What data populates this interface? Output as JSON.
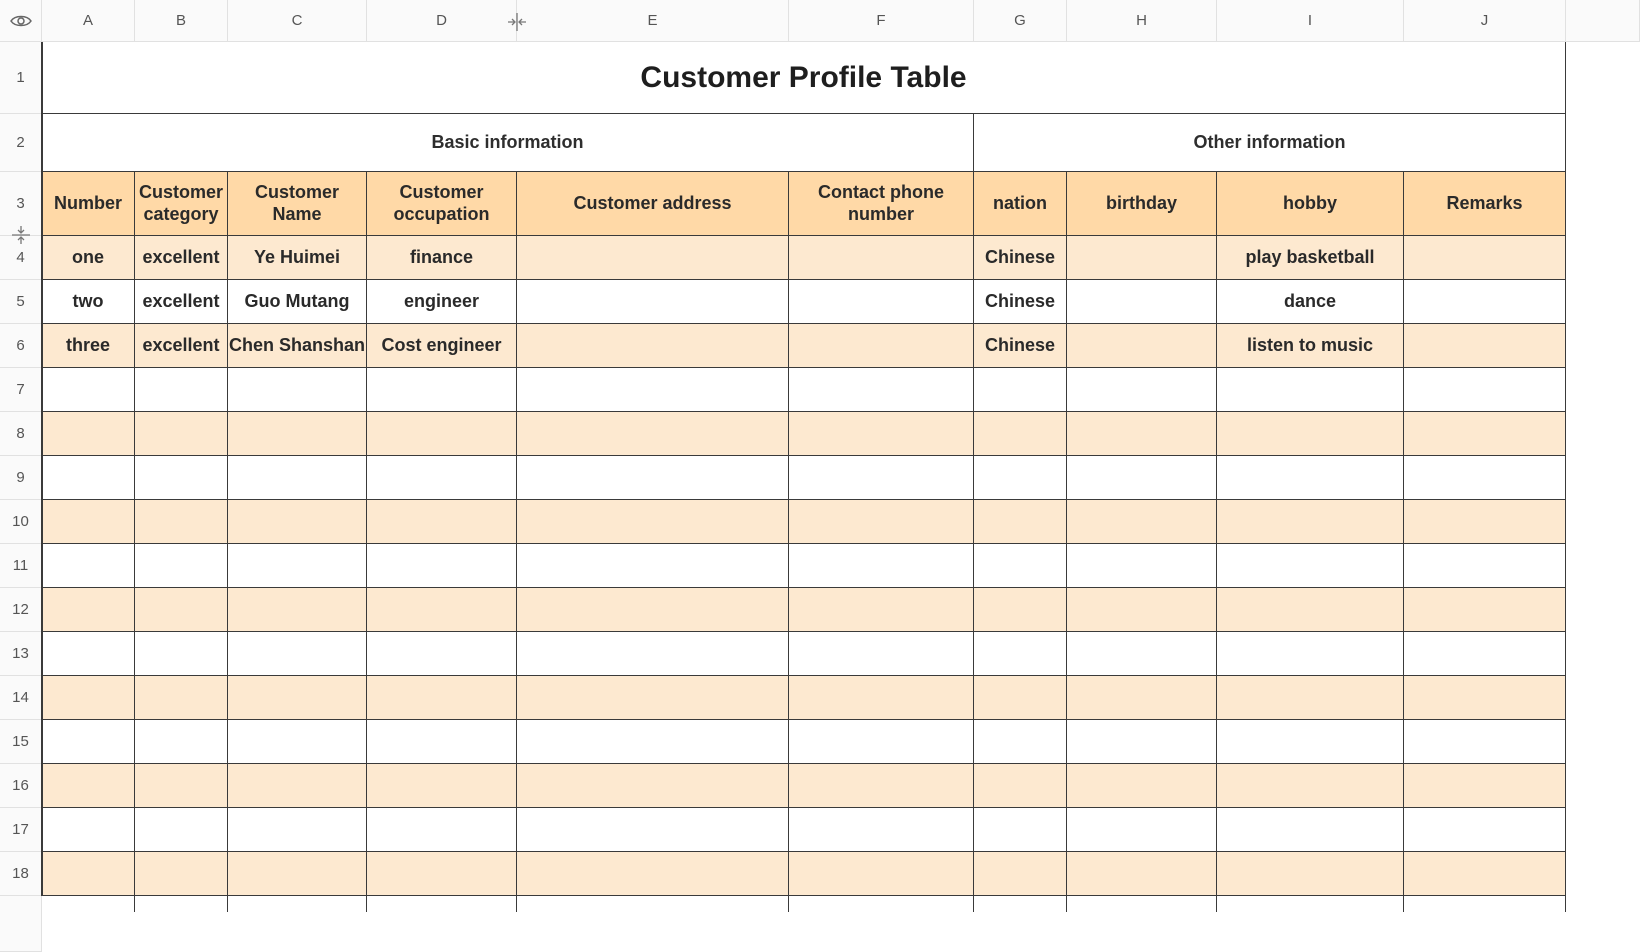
{
  "sheet": {
    "columns": [
      "A",
      "B",
      "C",
      "D",
      "E",
      "F",
      "G",
      "H",
      "I",
      "J"
    ],
    "rows": [
      "1",
      "2",
      "3",
      "4",
      "5",
      "6",
      "7",
      "8",
      "9",
      "10",
      "11",
      "12",
      "13",
      "14",
      "15",
      "16",
      "17",
      "18"
    ],
    "title": "Customer Profile Table",
    "sections": [
      "Basic information",
      "Other information"
    ],
    "headers": [
      "Number",
      "Customer category",
      "Customer Name",
      "Customer occupation",
      "Customer address",
      "Contact phone number",
      "nation",
      "birthday",
      "hobby",
      "Remarks"
    ],
    "records": [
      [
        "one",
        "excellent",
        "Ye Huimei",
        "finance",
        "",
        "",
        "Chinese",
        "",
        "play basketball",
        ""
      ],
      [
        "two",
        "excellent",
        "Guo Mutang",
        "engineer",
        "",
        "",
        "Chinese",
        "",
        "dance",
        ""
      ],
      [
        "three",
        "excellent",
        "Chen Shanshan",
        "Cost engineer",
        "",
        "",
        "Chinese",
        "",
        "listen to music",
        ""
      ]
    ],
    "empty_rows": 12
  },
  "colors": {
    "header_fill": "#ffd9a7",
    "band_fill": "#fde9d0",
    "grid_line": "#3a3a3a"
  },
  "icons": {
    "corner": "eye-icon",
    "column_resize": "column-resize-icon",
    "row_resize": "row-resize-icon"
  }
}
